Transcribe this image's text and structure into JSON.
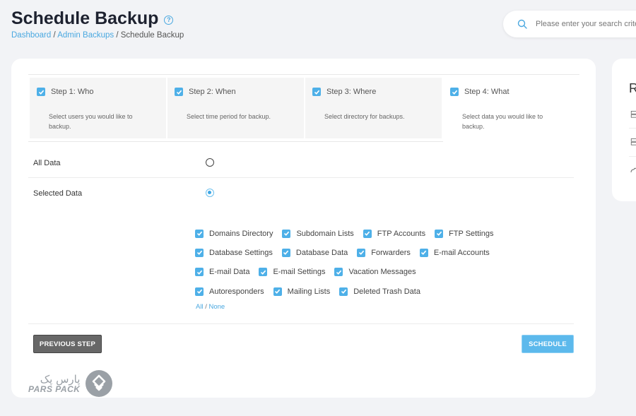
{
  "header": {
    "title": "Schedule Backup",
    "help_icon": "?",
    "breadcrumb": [
      {
        "label": "Dashboard",
        "link": true
      },
      {
        "label": "Admin Backups",
        "link": true
      },
      {
        "label": "Schedule Backup",
        "link": false
      }
    ],
    "separator": "/"
  },
  "search": {
    "placeholder": "Please enter your search criteria"
  },
  "steps": [
    {
      "label": "Step 1: Who",
      "description": "Select users you would like to backup.",
      "checked": true
    },
    {
      "label": "Step 2: When",
      "description": "Select time period for backup.",
      "checked": true
    },
    {
      "label": "Step 3: Where",
      "description": "Select directory for backups.",
      "checked": true
    },
    {
      "label": "Step 4: What",
      "description": "Select data you would like to backup.",
      "checked": true,
      "active": true
    }
  ],
  "data_selection": {
    "all_data_label": "All Data",
    "selected_data_label": "Selected Data",
    "selected": "Selected Data"
  },
  "options": [
    [
      "Domains Directory",
      "Subdomain Lists",
      "FTP Accounts",
      "FTP Settings"
    ],
    [
      "Database Settings",
      "Database Data",
      "Forwarders",
      "E-mail Accounts"
    ],
    [
      "E-mail Data",
      "E-mail Settings",
      "Vacation Messages"
    ],
    [
      "Autoresponders",
      "Mailing Lists",
      "Deleted Trash Data"
    ]
  ],
  "select_links": {
    "all": "All",
    "separator": "/",
    "none": "None"
  },
  "buttons": {
    "previous": "PREVIOUS STEP",
    "schedule": "SCHEDULE"
  },
  "side_panel": {
    "heading_letter": "R"
  },
  "logo": {
    "farsi": "پارس پک",
    "english": "PARS PACK"
  },
  "colors": {
    "accent": "#4eb0e8",
    "title": "#1e2230",
    "prev_button": "#676767",
    "schedule_button": "#5cb9ec"
  }
}
